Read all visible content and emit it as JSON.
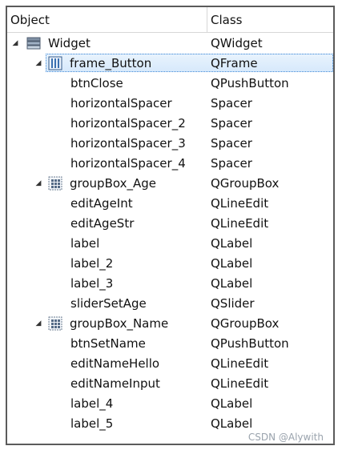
{
  "header": {
    "object": "Object",
    "class": "Class"
  },
  "tree": {
    "widget": {
      "object": "Widget",
      "class": "QWidget"
    },
    "frame_button": {
      "object": "frame_Button",
      "class": "QFrame"
    },
    "btnClose": {
      "object": "btnClose",
      "class": "QPushButton"
    },
    "hs1": {
      "object": "horizontalSpacer",
      "class": "Spacer"
    },
    "hs2": {
      "object": "horizontalSpacer_2",
      "class": "Spacer"
    },
    "hs3": {
      "object": "horizontalSpacer_3",
      "class": "Spacer"
    },
    "hs4": {
      "object": "horizontalSpacer_4",
      "class": "Spacer"
    },
    "groupBox_Age": {
      "object": "groupBox_Age",
      "class": "QGroupBox"
    },
    "editAgeInt": {
      "object": "editAgeInt",
      "class": "QLineEdit"
    },
    "editAgeStr": {
      "object": "editAgeStr",
      "class": "QLineEdit"
    },
    "label": {
      "object": "label",
      "class": "QLabel"
    },
    "label_2": {
      "object": "label_2",
      "class": "QLabel"
    },
    "label_3": {
      "object": "label_3",
      "class": "QLabel"
    },
    "sliderSetAge": {
      "object": "sliderSetAge",
      "class": "QSlider"
    },
    "groupBox_Name": {
      "object": "groupBox_Name",
      "class": "QGroupBox"
    },
    "btnSetName": {
      "object": "btnSetName",
      "class": "QPushButton"
    },
    "editNameHello": {
      "object": "editNameHello",
      "class": "QLineEdit"
    },
    "editNameInput": {
      "object": "editNameInput",
      "class": "QLineEdit"
    },
    "label_4": {
      "object": "label_4",
      "class": "QLabel"
    },
    "label_5": {
      "object": "label_5",
      "class": "QLabel"
    }
  },
  "watermark": "CSDN @Alywith",
  "colors": {
    "selection": "#d7e9fb",
    "border": "#5b5b5b",
    "accent": "#3a86d6"
  },
  "icons": {
    "widget": "widget-stack-icon",
    "frame": "frame-bars-icon",
    "groupbox": "groupbox-grid-icon",
    "expand": "expand-arrow-icon"
  }
}
